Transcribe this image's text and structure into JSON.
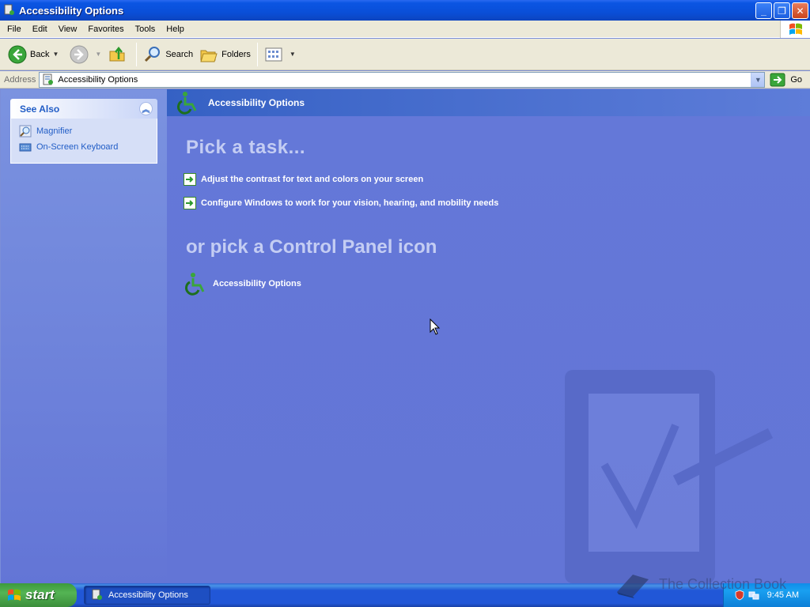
{
  "window": {
    "title": "Accessibility Options"
  },
  "menu": [
    "File",
    "Edit",
    "View",
    "Favorites",
    "Tools",
    "Help"
  ],
  "toolbar": {
    "back": "Back",
    "search": "Search",
    "folders": "Folders"
  },
  "address": {
    "label": "Address",
    "value": "Accessibility Options",
    "go": "Go"
  },
  "see_also": {
    "title": "See Also",
    "items": [
      "Magnifier",
      "On-Screen Keyboard"
    ]
  },
  "main": {
    "header": "Accessibility Options",
    "pick_task": "Pick a task...",
    "tasks": [
      "Adjust the contrast for text and colors on your screen",
      "Configure Windows to work for your vision, hearing, and mobility needs"
    ],
    "pick_icon": "or pick a Control Panel icon",
    "icons": [
      "Accessibility Options"
    ]
  },
  "taskbar": {
    "start": "start",
    "task": "Accessibility Options",
    "time": "9:45 AM"
  },
  "brand": "The Collection Book",
  "colors": {
    "accent": "#215dc6",
    "panel": "#6375d6",
    "taskbar": "#2157d7",
    "start": "#3b8e3b"
  }
}
